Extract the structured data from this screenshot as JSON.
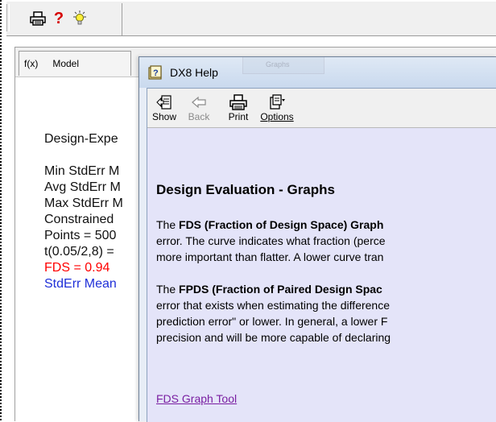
{
  "toolbar": {
    "icons": [
      "printer-icon",
      "help-question-icon",
      "tip-bulb-icon"
    ],
    "help_glyph": "?"
  },
  "tabs": {
    "model": {
      "fx": "f(x)",
      "label": "Model"
    }
  },
  "content": {
    "lines": [
      {
        "text": "Design-Expe",
        "color": "#111111"
      },
      {
        "text": "",
        "color": "#111111"
      },
      {
        "text": "Min StdErr M",
        "color": "#111111"
      },
      {
        "text": "Avg StdErr M",
        "color": "#111111"
      },
      {
        "text": "Max StdErr M",
        "color": "#111111"
      },
      {
        "text": "Constrained",
        "color": "#111111"
      },
      {
        "text": "Points = 500",
        "color": "#111111"
      },
      {
        "text": "t(0.05/2,8) =",
        "color": "#111111"
      },
      {
        "text": "FDS = 0.94",
        "color": "#ff0000"
      },
      {
        "text": "StdErr Mean",
        "color": "#1f2fd8"
      }
    ]
  },
  "help_window": {
    "title": "DX8 Help",
    "ghost_tab": "Graphs",
    "buttons": {
      "show": "Show",
      "back": "Back",
      "print": "Print",
      "options": "Options"
    },
    "heading": "Design Evaluation - Graphs",
    "para1": {
      "prefix": "The ",
      "bold": "FDS (Fraction of Design Space) Graph",
      "line2": "error.  The curve indicates what fraction (perce",
      "line3": "more important than flatter.  A lower curve tran"
    },
    "para2": {
      "prefix": "The ",
      "bold": "FPDS (Fraction of Paired Design Spac",
      "line2": "error that exists when estimating the difference",
      "line3": "prediction error\" or lower.  In general, a lower F",
      "line4": "precision and will be more capable of declaring"
    },
    "link": "FDS Graph Tool"
  }
}
